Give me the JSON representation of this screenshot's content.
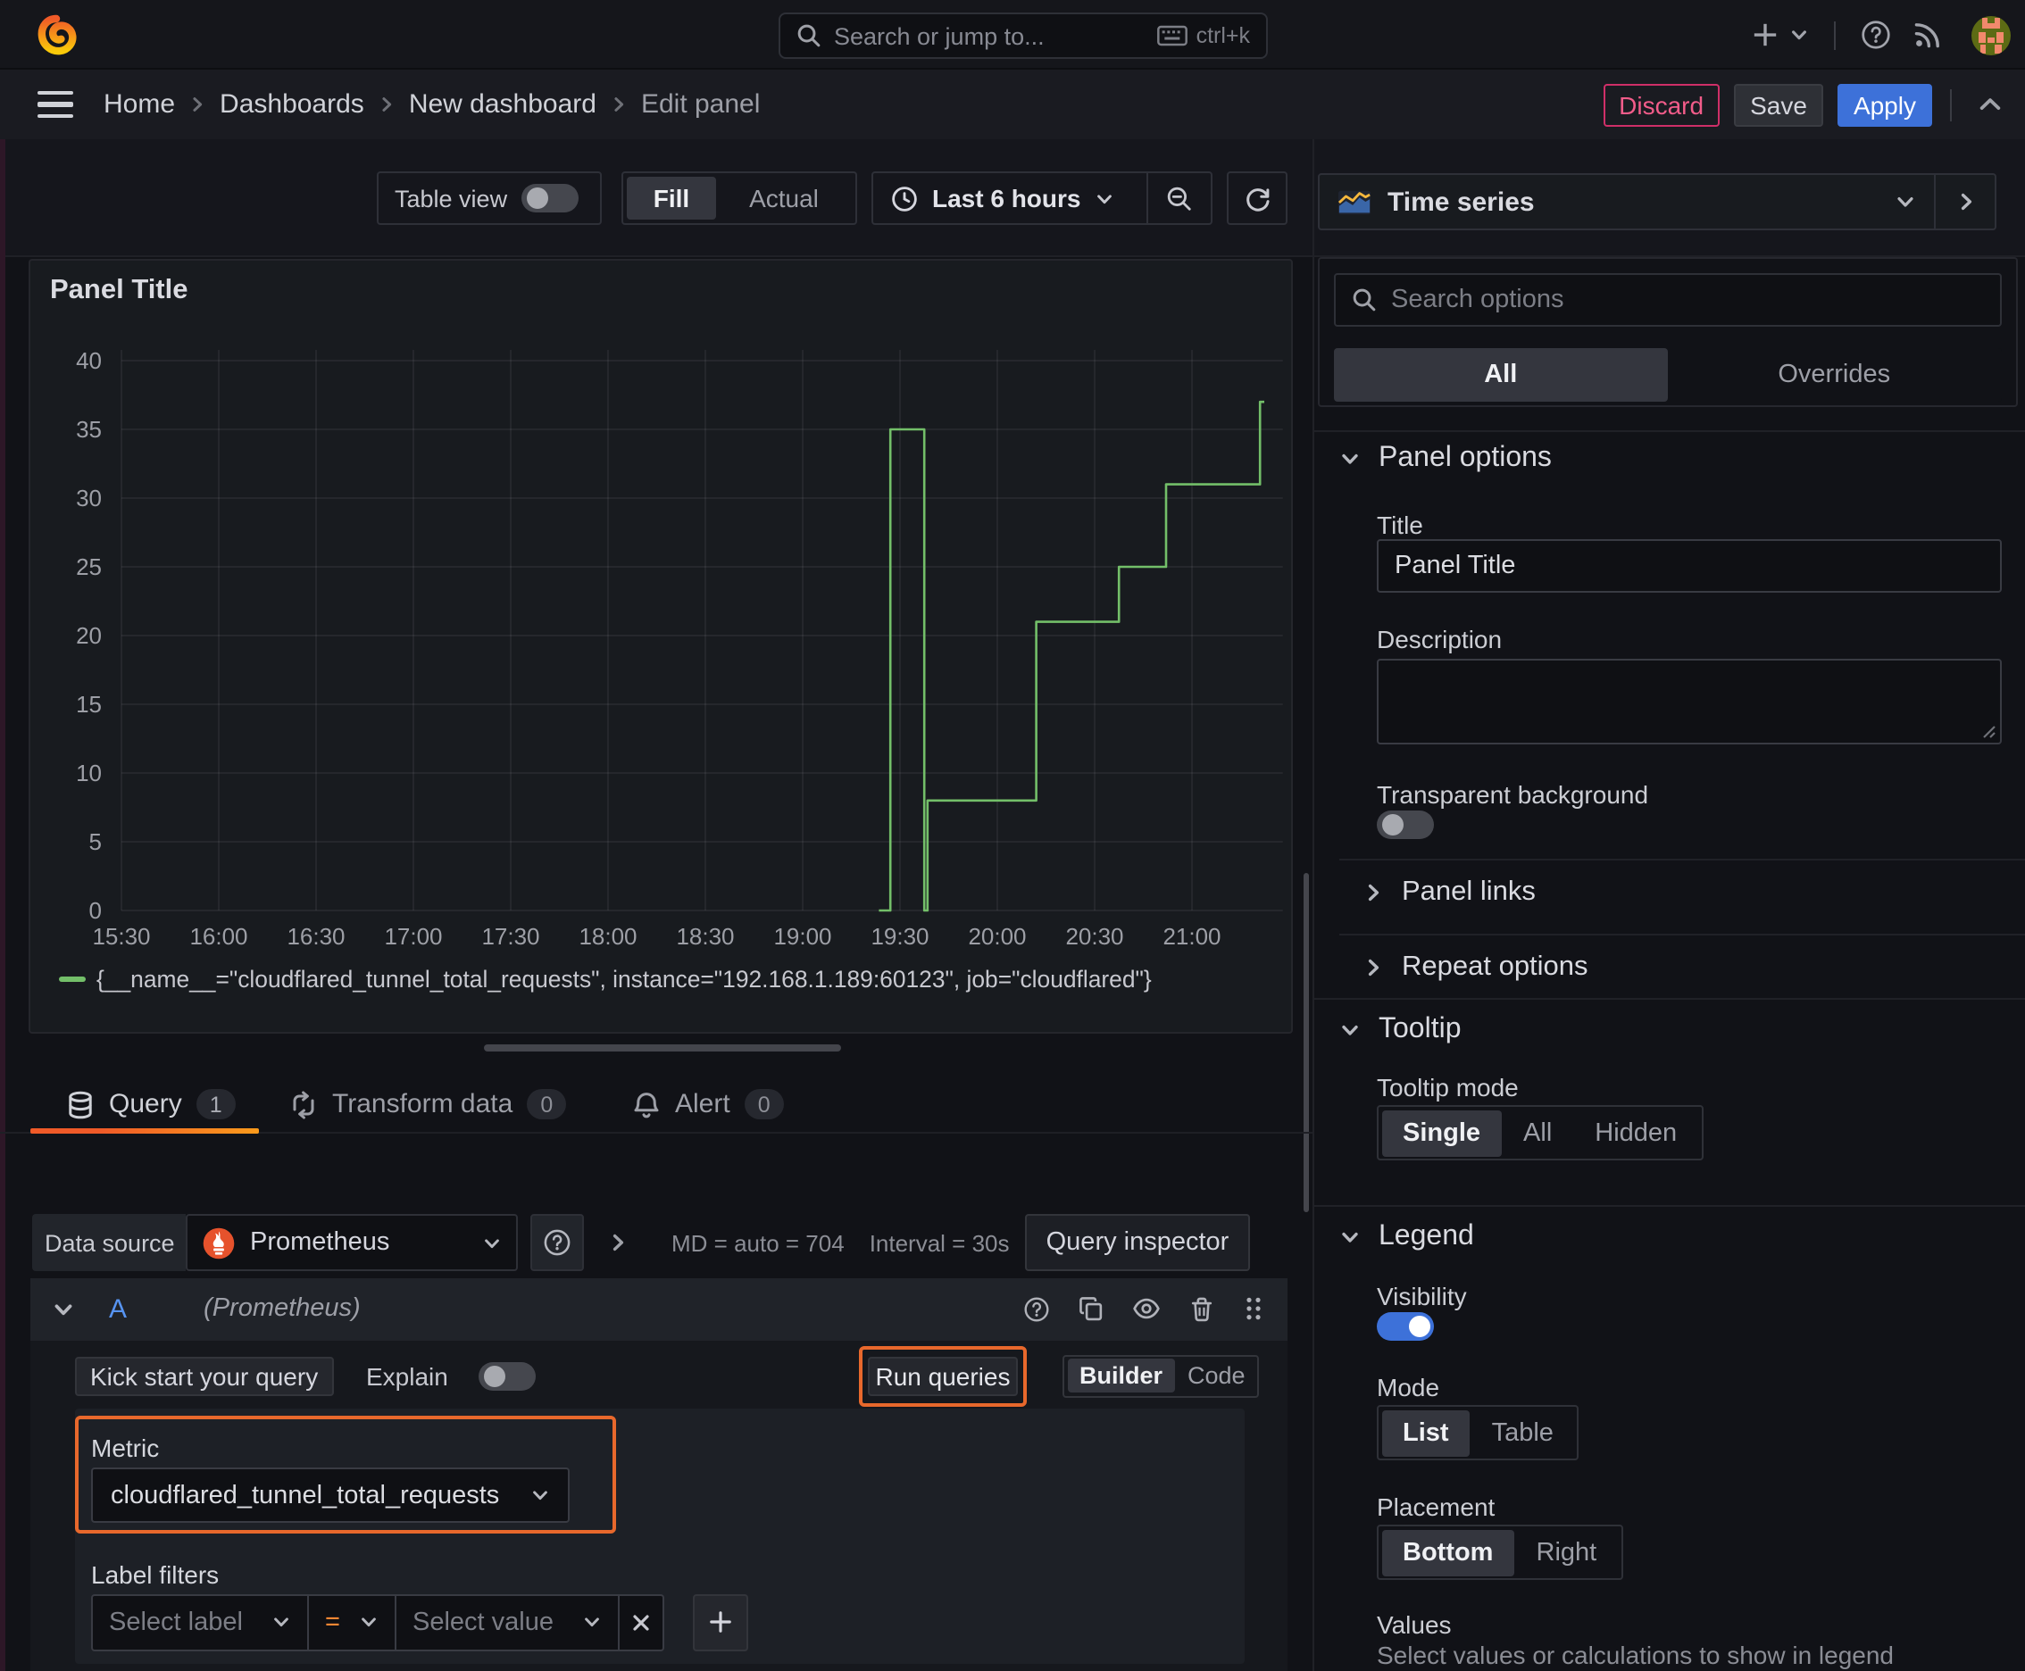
{
  "topbar": {
    "search_placeholder": "Search or jump to...",
    "search_shortcut": "ctrl+k"
  },
  "breadcrumbs": [
    "Home",
    "Dashboards",
    "New dashboard",
    "Edit panel"
  ],
  "actions": {
    "discard": "Discard",
    "save": "Save",
    "apply": "Apply"
  },
  "toolbar": {
    "table_view": "Table view",
    "fill": "Fill",
    "actual": "Actual",
    "time_range": "Last 6 hours"
  },
  "tabs": {
    "query": "Query",
    "query_count": "1",
    "transform": "Transform data",
    "transform_count": "0",
    "alert": "Alert",
    "alert_count": "0"
  },
  "datasource": {
    "label": "Data source",
    "name": "Prometheus",
    "stat_md": "MD = auto = 704",
    "stat_interval": "Interval = 30s",
    "inspector": "Query inspector"
  },
  "query": {
    "ref_id": "A",
    "ds_hint": "(Prometheus)",
    "kick_start": "Kick start your query",
    "explain": "Explain",
    "run_queries": "Run queries",
    "builder": "Builder",
    "code": "Code",
    "metric_label": "Metric",
    "metric_value": "cloudflared_tunnel_total_requests",
    "label_filters": "Label filters",
    "select_label_placeholder": "Select label",
    "operator": "=",
    "select_value_placeholder": "Select value"
  },
  "options": {
    "visualization": "Time series",
    "search_placeholder": "Search options",
    "tab_all": "All",
    "tab_overrides": "Overrides",
    "panel_options": "Panel options",
    "title_label": "Title",
    "title_value": "Panel Title",
    "description_label": "Description",
    "transparent_background": "Transparent background",
    "panel_links": "Panel links",
    "repeat_options": "Repeat options",
    "tooltip": "Tooltip",
    "tooltip_mode": "Tooltip mode",
    "tooltip_modes": [
      "Single",
      "All",
      "Hidden"
    ],
    "legend": "Legend",
    "visibility": "Visibility",
    "mode": "Mode",
    "modes": [
      "List",
      "Table"
    ],
    "placement": "Placement",
    "placements": [
      "Bottom",
      "Right"
    ],
    "values_label": "Values",
    "values_hint": "Select values or calculations to show in legend"
  },
  "colors": {
    "accent_blue": "#3d71d9",
    "discard_pink": "#cf2f68",
    "highlight_orange": "#e8682c",
    "series_green": "#73bf69",
    "tab_underline": "#f05a28"
  },
  "chart_data": {
    "type": "line",
    "step": true,
    "title": "Panel Title",
    "xlabel": "",
    "ylabel": "",
    "ylim": [
      0,
      40
    ],
    "y_tick_step": 5,
    "x_ticks": [
      "15:30",
      "16:00",
      "16:30",
      "17:00",
      "17:30",
      "18:00",
      "18:30",
      "19:00",
      "19:30",
      "20:00",
      "20:30",
      "21:00"
    ],
    "x_tick_minutes": [
      0,
      30,
      60,
      90,
      120,
      150,
      180,
      210,
      240,
      270,
      300,
      330
    ],
    "x_range_minutes": [
      0,
      358
    ],
    "grid": true,
    "legend_position": "bottom",
    "series": [
      {
        "name": "{__name__=\"cloudflared_tunnel_total_requests\", instance=\"192.168.1.189:60123\", job=\"cloudflared\"}",
        "color": "#73bf69",
        "points_t_minutes_after_1530": [
          [
            233.5,
            0
          ],
          [
            237,
            35
          ],
          [
            247.5,
            0
          ],
          [
            248.5,
            8
          ],
          [
            282,
            21
          ],
          [
            307.5,
            25
          ],
          [
            322,
            31
          ],
          [
            351,
            37
          ]
        ],
        "end_t": 352.3
      }
    ]
  }
}
